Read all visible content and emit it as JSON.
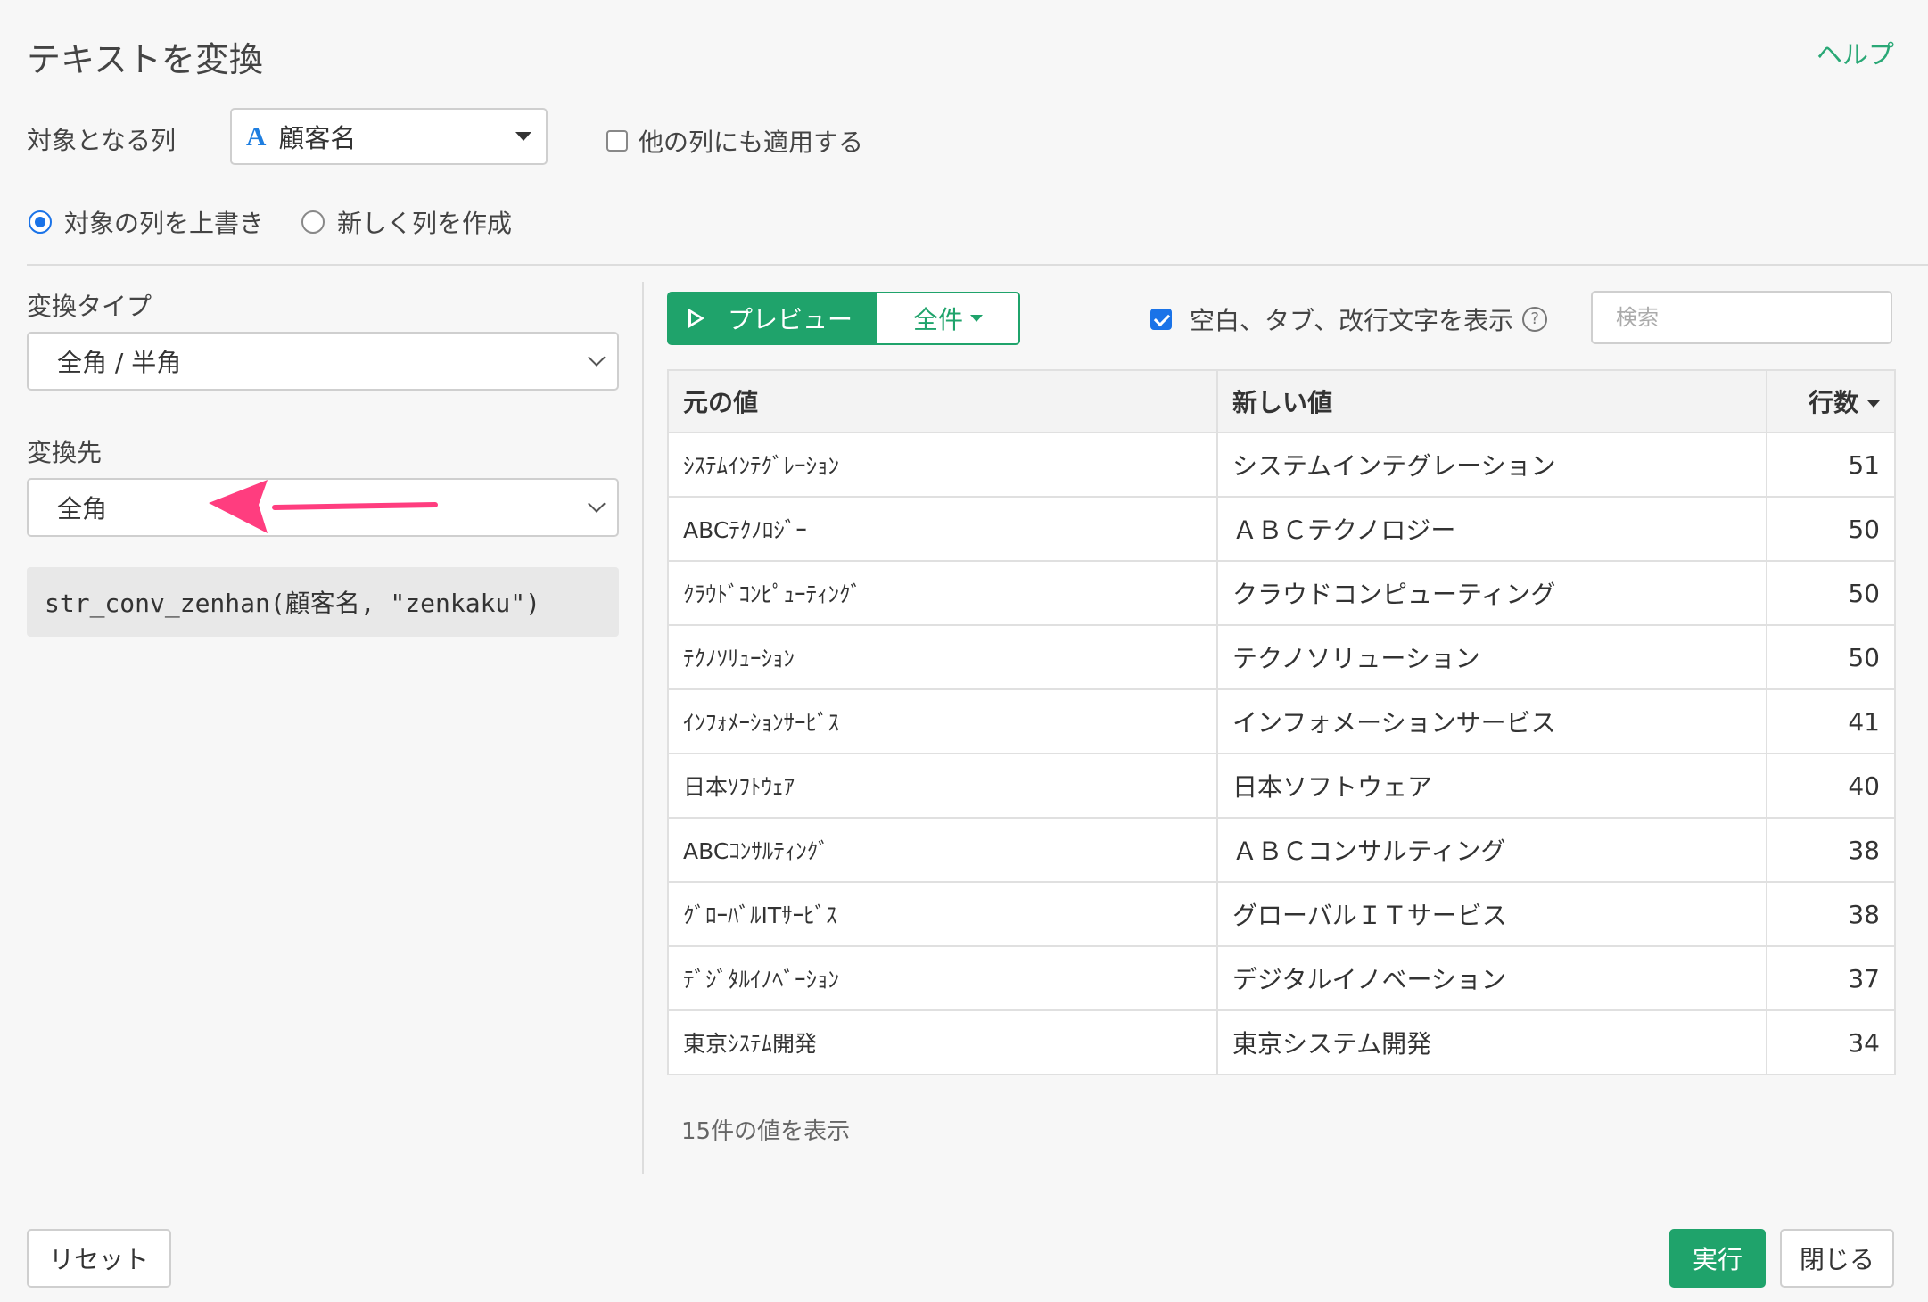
{
  "dialog": {
    "title": "テキストを変換",
    "help_link": "ヘルプ"
  },
  "target": {
    "label": "対象となる列",
    "column_type_icon": "A",
    "column_value": "顧客名",
    "apply_other_label": "他の列にも適用する",
    "apply_other_checked": false
  },
  "mode": {
    "overwrite_label": "対象の列を上書き",
    "new_column_label": "新しく列を作成",
    "selected": "overwrite"
  },
  "conversion": {
    "type_label": "変換タイプ",
    "type_value": "全角 / 半角",
    "dest_label": "変換先",
    "dest_value": "全角",
    "code": "str_conv_zenhan(顧客名, \"zenkaku\")",
    "annotation_arrow_color": "#ff3d7f"
  },
  "preview": {
    "preview_button": "プレビュー",
    "scope_button": "全件",
    "show_whitespace_label": "空白、タブ、改行文字を表示",
    "show_whitespace_checked": true,
    "help_icon_glyph": "?",
    "search_placeholder": "検索",
    "search_value": ""
  },
  "table": {
    "headers": [
      "元の値",
      "新しい値",
      "行数"
    ],
    "rows": [
      {
        "orig": "ｼｽﾃﾑｲﾝﾃｸﾞﾚｰｼｮﾝ",
        "new": "システムインテグレーション",
        "count": "51"
      },
      {
        "orig": "ABCﾃｸﾉﾛｼﾞｰ",
        "new": "ＡＢＣテクノロジー",
        "count": "50"
      },
      {
        "orig": "ｸﾗｳﾄﾞｺﾝﾋﾟｭｰﾃｨﾝｸﾞ",
        "new": "クラウドコンピューティング",
        "count": "50"
      },
      {
        "orig": "ﾃｸﾉｿﾘｭｰｼｮﾝ",
        "new": "テクノソリューション",
        "count": "50"
      },
      {
        "orig": "ｲﾝﾌｫﾒｰｼｮﾝｻｰﾋﾞｽ",
        "new": "インフォメーションサービス",
        "count": "41"
      },
      {
        "orig": "日本ｿﾌﾄｳｪｱ",
        "new": "日本ソフトウェア",
        "count": "40"
      },
      {
        "orig": "ABCｺﾝｻﾙﾃｨﾝｸﾞ",
        "new": "ＡＢＣコンサルティング",
        "count": "38"
      },
      {
        "orig": "ｸﾞﾛｰﾊﾞﾙITｻｰﾋﾞｽ",
        "new": "グローバルＩＴサービス",
        "count": "38"
      },
      {
        "orig": "ﾃﾞｼﾞﾀﾙｲﾉﾍﾞｰｼｮﾝ",
        "new": "デジタルイノベーション",
        "count": "37"
      },
      {
        "orig": "東京ｼｽﾃﾑ開発",
        "new": "東京システム開発",
        "count": "34"
      }
    ],
    "footer_note": "15件の値を表示"
  },
  "footer": {
    "reset": "リセット",
    "run": "実行",
    "close": "閉じる"
  },
  "colors": {
    "accent_green": "#1fa36b",
    "checkbox_blue": "#1a73e8"
  }
}
